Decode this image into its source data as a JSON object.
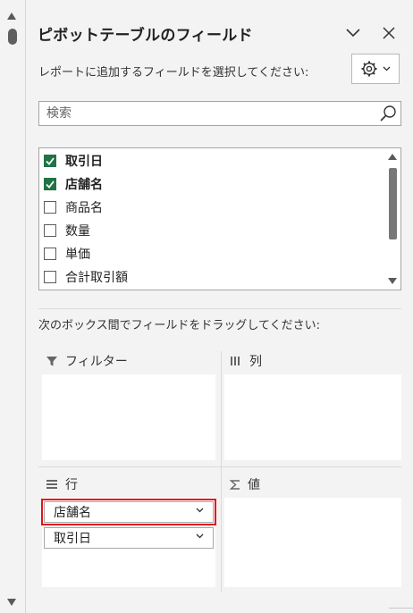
{
  "pane": {
    "title": "ピボットテーブルのフィールド",
    "subtitle": "レポートに追加するフィールドを選択してください:",
    "search_placeholder": "検索",
    "drag_instruction": "次のボックス間でフィールドをドラッグしてください:"
  },
  "fields": [
    {
      "label": "取引日",
      "checked": true
    },
    {
      "label": "店舗名",
      "checked": true
    },
    {
      "label": "商品名",
      "checked": false
    },
    {
      "label": "数量",
      "checked": false
    },
    {
      "label": "単価",
      "checked": false
    },
    {
      "label": "合計取引額",
      "checked": false
    }
  ],
  "areas": {
    "filter": {
      "label": "フィルター",
      "icon": "filter-icon"
    },
    "columns": {
      "label": "列",
      "icon": "columns-icon"
    },
    "rows": {
      "label": "行",
      "icon": "rows-icon",
      "items": [
        "店舗名",
        "取引日"
      ]
    },
    "values": {
      "label": "値",
      "icon": "sigma-icon"
    }
  },
  "colors": {
    "checkbox_checked": "#217346",
    "highlight": "#e0141e",
    "pane_bg": "#f3f3f3"
  },
  "icons": [
    "chevron-down-icon",
    "close-icon",
    "gear-icon",
    "search-icon",
    "filter-icon",
    "columns-icon",
    "rows-icon",
    "sigma-icon"
  ]
}
